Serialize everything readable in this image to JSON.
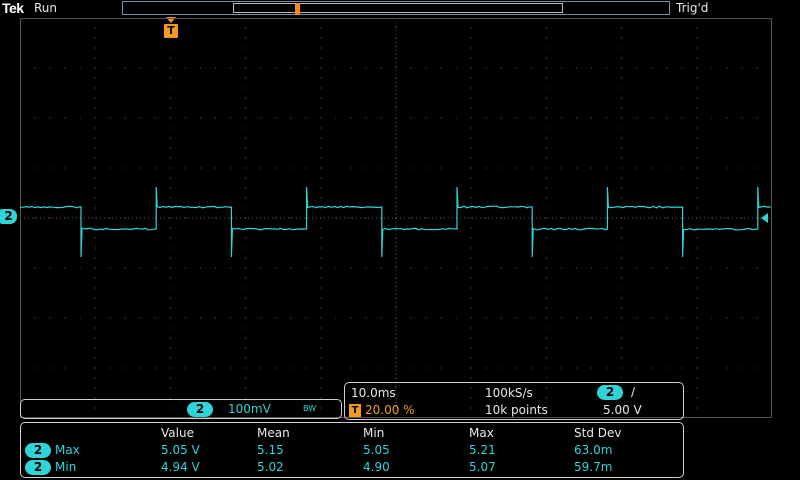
{
  "header": {
    "brand": "Tek",
    "acquisition_state": "Run",
    "trigger_state": "Trig'd"
  },
  "trigger_marker": {
    "label": "T"
  },
  "channel": {
    "number": "2",
    "color": "#2fd4d8",
    "scale": "100mV",
    "bandwidth_icon": "BW"
  },
  "timebase": {
    "time_per_div": "10.0ms",
    "sample_rate": "100kS/s",
    "trigger_icon": "T",
    "trigger_position": "20.00 %",
    "record_length": "10k points",
    "trigger_source": "2",
    "trigger_slope_icon": "rising-edge",
    "trigger_slope_glyph": "/",
    "trigger_level": "5.00 V"
  },
  "measurements": {
    "headers": [
      "Value",
      "Mean",
      "Min",
      "Max",
      "Std Dev"
    ],
    "rows": [
      {
        "channel": "2",
        "name": "Max",
        "values": [
          "5.05 V",
          "5.15",
          "5.05",
          "5.21",
          "63.0m"
        ]
      },
      {
        "channel": "2",
        "name": "Min",
        "values": [
          "4.94 V",
          "5.02",
          "4.90",
          "5.07",
          "59.7m"
        ]
      }
    ]
  },
  "waveform": {
    "color": "#2fd4d8",
    "type": "square",
    "period_ms": 20,
    "high_level_v": 5.05,
    "low_level_v": 4.94
  }
}
